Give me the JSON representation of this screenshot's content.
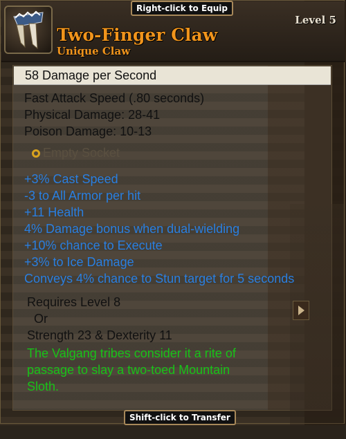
{
  "tabs": {
    "equip": "Right-click to Equip",
    "transfer": "Shift-click to Transfer"
  },
  "item": {
    "icon": "claw-icon",
    "name": "Two-Finger Claw",
    "type": "Unique Claw",
    "level": "Level 5"
  },
  "stats": {
    "dps": "58  Damage per Second",
    "attack_speed": "Fast Attack Speed (.80 seconds)",
    "physical": "Physical Damage: 28-41",
    "poison": "Poison Damage: 10-13"
  },
  "socket": {
    "label": "Empty Socket",
    "ring_color": "#d9a31e"
  },
  "modifiers": [
    "+3% Cast Speed",
    "-3 to All Armor per hit",
    "+11 Health",
    "4% Damage bonus when dual-wielding",
    "+10% chance to Execute",
    "+3% to Ice Damage",
    "Conveys 4% chance to Stun target for 5 seconds"
  ],
  "requirements": {
    "level": "Requires Level 8",
    "or": "Or",
    "attributes": "Strength 23 & Dexterity 11"
  },
  "lore": [
    "The Valgang tribes consider it a rite of",
    "passage to slay a two-toed Mountain",
    "Sloth."
  ],
  "colors": {
    "title": "#f0941c",
    "modifier": "#2a7fe0",
    "lore": "#18c218"
  }
}
